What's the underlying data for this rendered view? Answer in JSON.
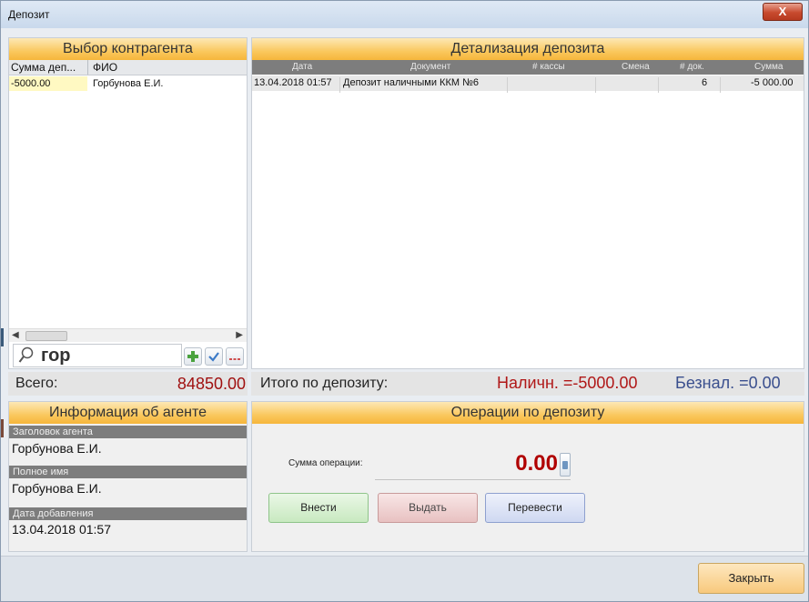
{
  "window": {
    "title": "Депозит",
    "close_glyph": "X"
  },
  "contractor": {
    "header": "Выбор контрагента",
    "columns": [
      "Сумма деп...",
      "ФИО"
    ],
    "rows": [
      {
        "sum": "-5000.00",
        "fio": "Горбунова Е.И."
      }
    ],
    "search_text": "гор",
    "total_label": "Всего:",
    "total_value": "84850.00"
  },
  "detail": {
    "header": "Детализация депозита",
    "columns": [
      "Дата",
      "Документ",
      "# кассы",
      "Смена",
      "# док.",
      "Сумма"
    ],
    "rows": [
      {
        "date": "13.04.2018 01:57",
        "document": "Депозит наличными ККМ №6",
        "kassa": "",
        "smena": "",
        "doc_no": "6",
        "sum": "-5 000.00"
      }
    ],
    "itogo_label": "Итого по депозиту:",
    "nal": "Наличн. =-5000.00",
    "beznal": "Безнал. =0.00"
  },
  "agent": {
    "header": "Информация об агенте",
    "fields": [
      {
        "caption": "Заголовок агента",
        "value": "Горбунова Е.И."
      },
      {
        "caption": "Полное имя",
        "value": "Горбунова Е.И."
      },
      {
        "caption": "Дата добавления",
        "value": "13.04.2018 01:57"
      }
    ]
  },
  "operations": {
    "header": "Операции по депозиту",
    "sum_label": "Сумма операции:",
    "sum_value": "0.00",
    "buttons": {
      "deposit": "Внести",
      "withdraw": "Выдать",
      "transfer": "Перевести"
    }
  },
  "footer": {
    "close_label": "Закрыть"
  },
  "icons": {
    "search": "search-icon",
    "add": "plus-icon",
    "check": "check-icon",
    "dots": "dots-icon",
    "calc": "calculator-icon"
  },
  "colors": {
    "accent_orange": "#f6b63b",
    "total_red": "#a01010",
    "beznal_blue": "#3a4f8e"
  }
}
